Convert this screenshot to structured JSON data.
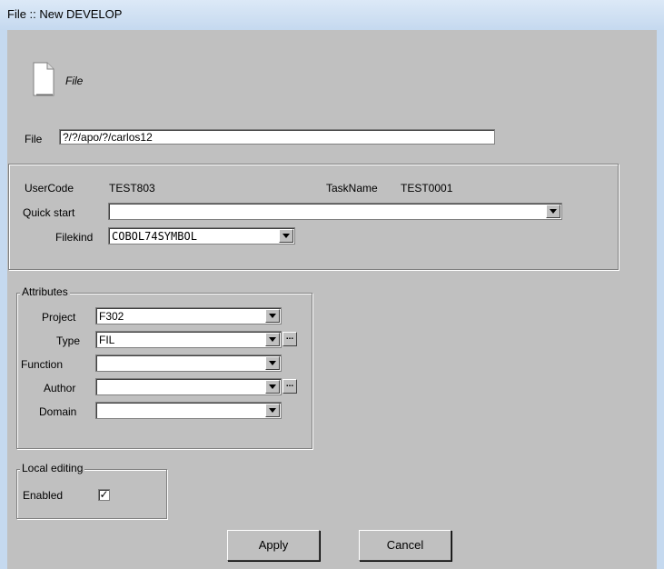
{
  "window": {
    "title": "File :: New DEVELOP"
  },
  "header": {
    "icon": "document-icon",
    "caption": "File"
  },
  "file": {
    "label": "File",
    "value": "?/?/apo/?/carlos12"
  },
  "info": {
    "usercode_label": "UserCode",
    "usercode_value": "TEST803",
    "taskname_label": "TaskName",
    "taskname_value": "TEST0001",
    "quickstart_label": "Quick start",
    "quickstart_value": "",
    "filekind_label": "Filekind",
    "filekind_value": "COBOL74SYMBOL"
  },
  "attributes": {
    "legend": "Attributes",
    "project_label": "Project",
    "project_value": "F302",
    "type_label": "Type",
    "type_value": "FIL",
    "function_label": "Function",
    "function_value": "",
    "author_label": "Author",
    "author_value": "",
    "domain_label": "Domain",
    "domain_value": ""
  },
  "local_editing": {
    "legend": "Local editing",
    "enabled_label": "Enabled",
    "enabled_checked": true,
    "check_glyph": "✓"
  },
  "buttons": {
    "apply": "Apply",
    "cancel": "Cancel",
    "ellipsis": "..."
  }
}
